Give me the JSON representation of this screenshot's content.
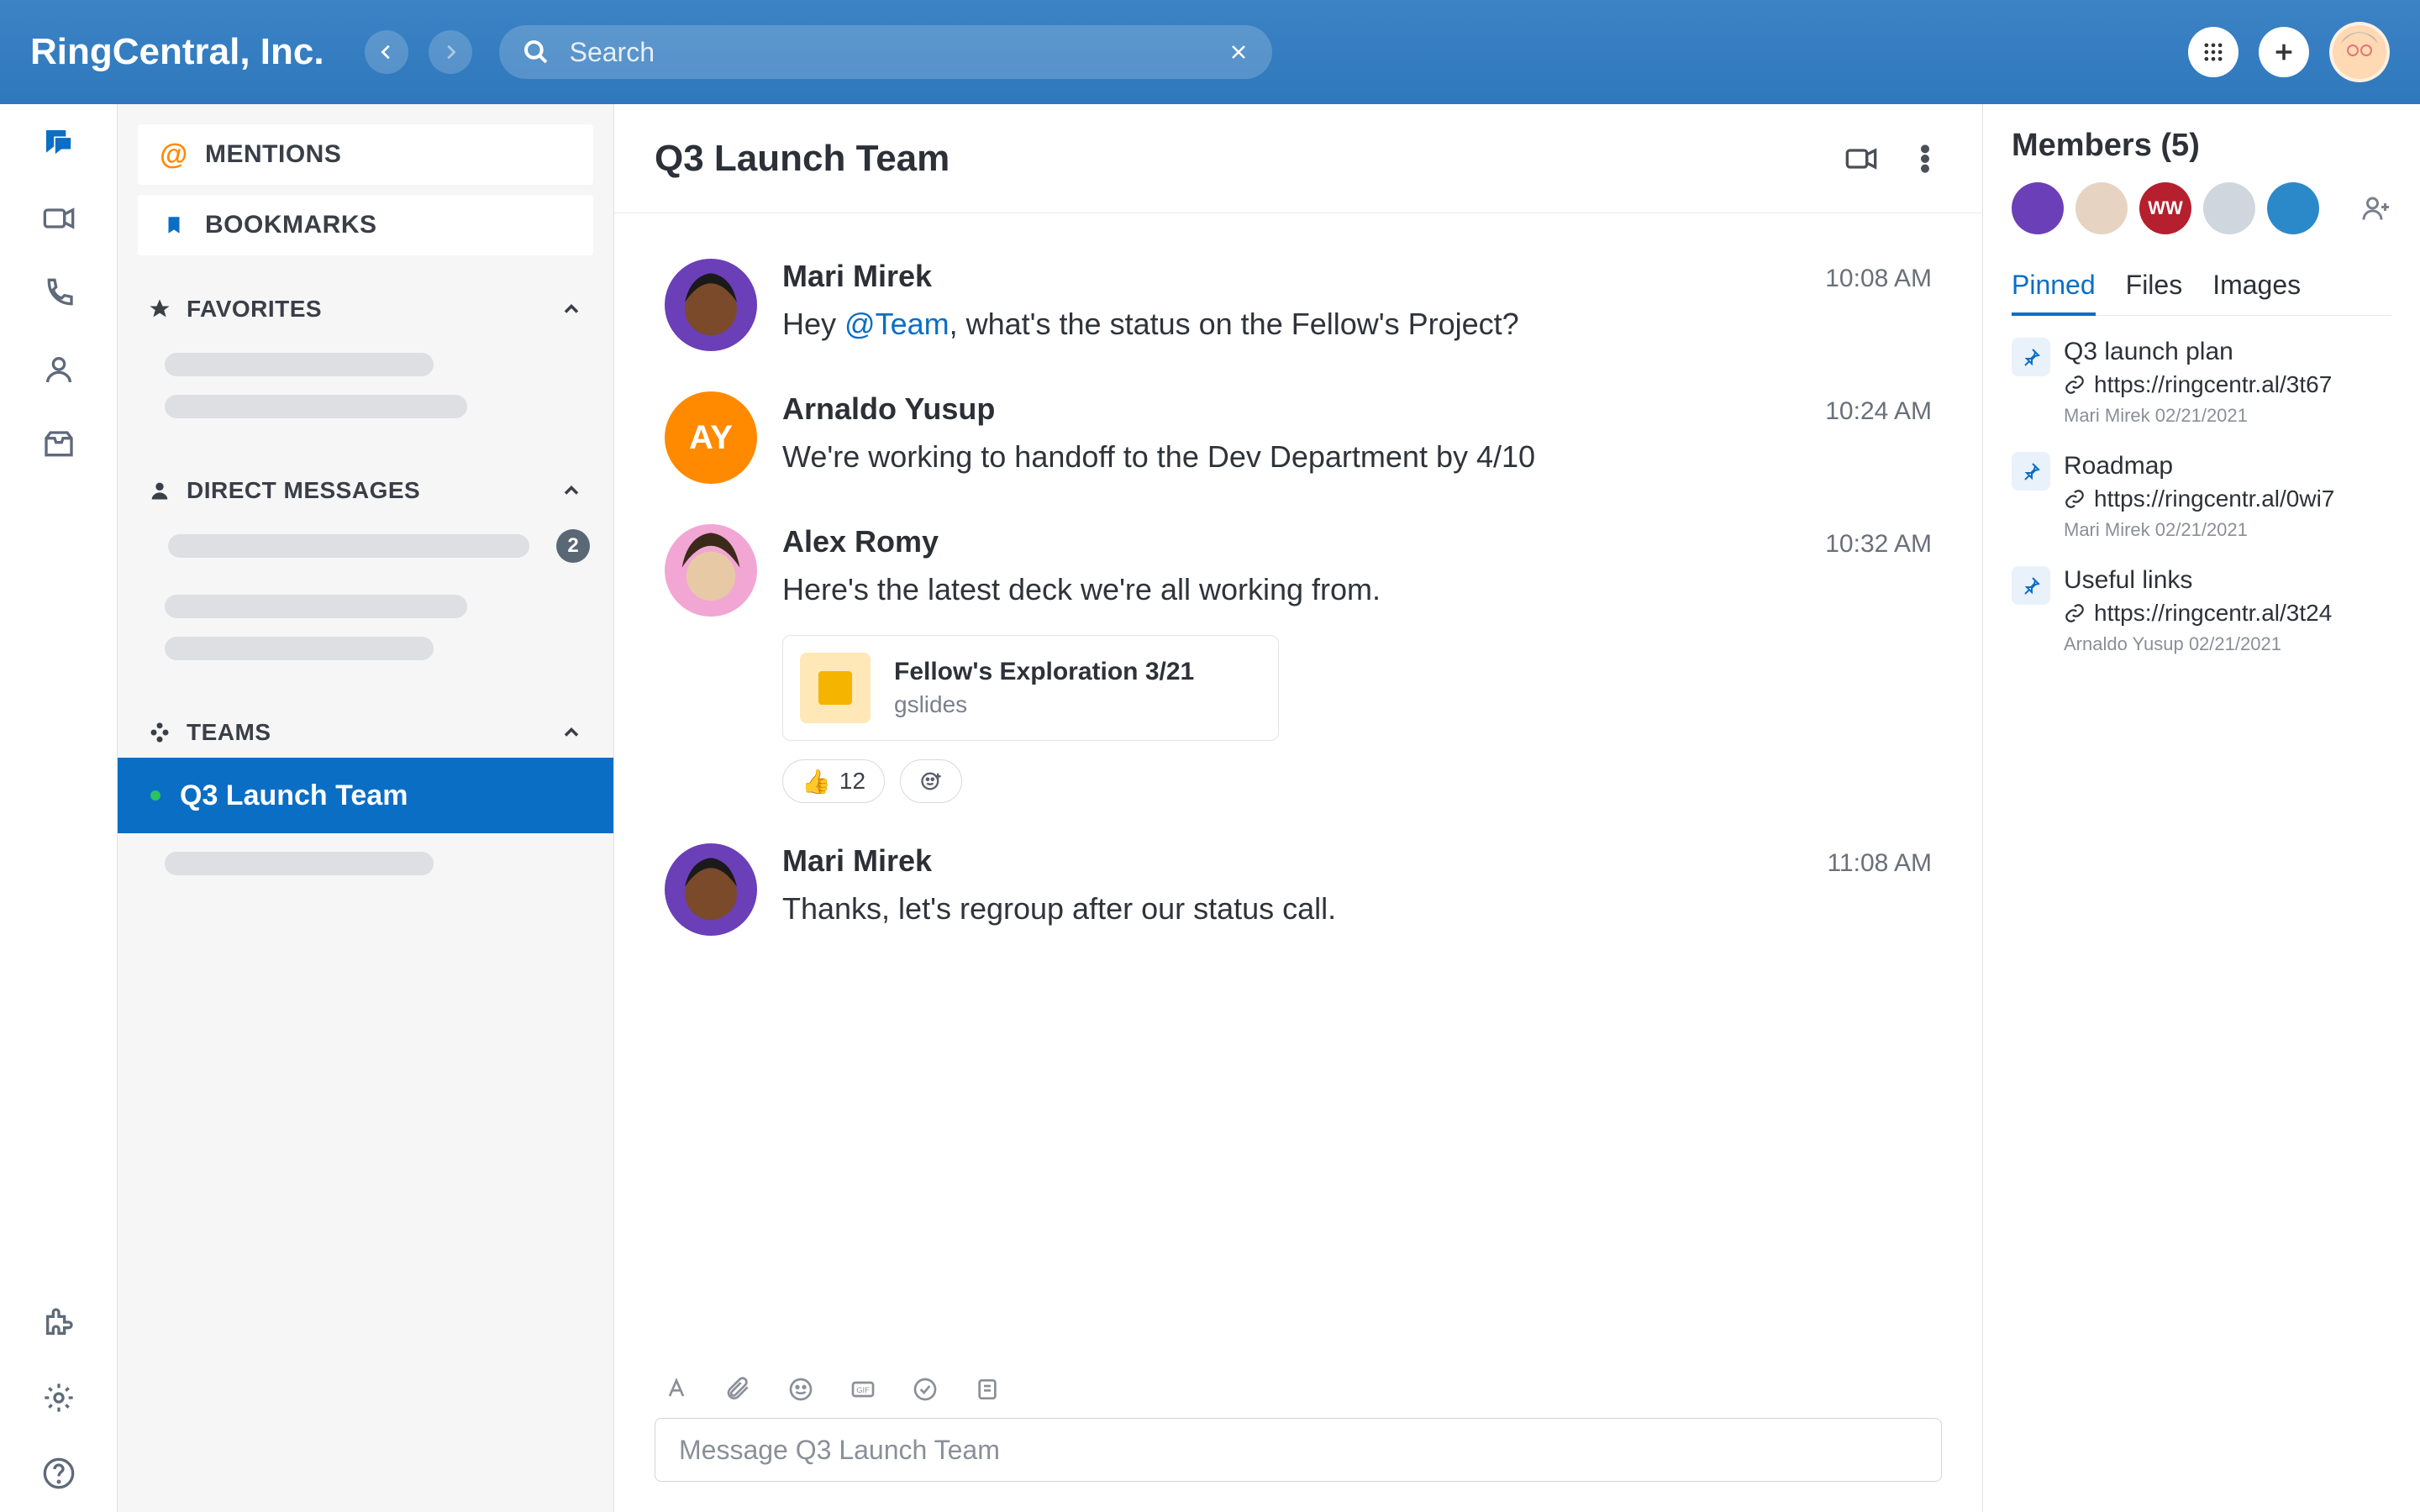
{
  "brand": "RingCentral, Inc.",
  "search": {
    "placeholder": "Search"
  },
  "sidebar": {
    "mentions": "MENTIONS",
    "bookmarks": "BOOKMARKS",
    "favorites": "FAVORITES",
    "direct_messages": "DIRECT MESSAGES",
    "dm_badge": "2",
    "teams": "TEAMS",
    "team_items": [
      {
        "name": "Q3 Launch Team",
        "active": true
      }
    ]
  },
  "chat": {
    "title": "Q3 Launch Team",
    "messages": [
      {
        "author": "Mari Mirek",
        "time": "10:08 AM",
        "text_pre": "Hey ",
        "mention": "@Team",
        "text_post": ", what's the status on the Fellow's Project?",
        "avatar_bg": "#6b3fb8"
      },
      {
        "author": "Arnaldo Yusup",
        "time": "10:24 AM",
        "text": "We're working to handoff to the Dev Department by 4/10",
        "initials": "AY",
        "avatar_bg": "#ff8a00"
      },
      {
        "author": "Alex Romy",
        "time": "10:32 AM",
        "text": "Here's the latest deck we're all working from.",
        "avatar_bg": "#e97fbf",
        "attachment": {
          "title": "Fellow's Exploration 3/21",
          "type": "gslides"
        },
        "reaction": {
          "emoji": "👍",
          "count": "12"
        }
      },
      {
        "author": "Mari Mirek",
        "time": "11:08 AM",
        "text": "Thanks, let's regroup after our status call.",
        "avatar_bg": "#6b3fb8"
      }
    ],
    "composer_placeholder": "Message Q3 Launch Team"
  },
  "panel": {
    "title": "Members (5)",
    "members": [
      {
        "bg": "#6b3fb8"
      },
      {
        "bg": "#e6d3c2"
      },
      {
        "bg": "#b51f2e",
        "label": "WW"
      },
      {
        "bg": "#cfd6de"
      },
      {
        "bg": "#2c89c9"
      }
    ],
    "tabs": {
      "pinned": "Pinned",
      "files": "Files",
      "images": "Images"
    },
    "pins": [
      {
        "title": "Q3 launch plan",
        "link": "https://ringcentr.al/3t67",
        "meta": "Mari Mirek 02/21/2021"
      },
      {
        "title": "Roadmap",
        "link": "https://ringcentr.al/0wi7",
        "meta": "Mari Mirek 02/21/2021"
      },
      {
        "title": "Useful links",
        "link": "https://ringcentr.al/3t24",
        "meta": "Arnaldo Yusup 02/21/2021"
      }
    ]
  }
}
